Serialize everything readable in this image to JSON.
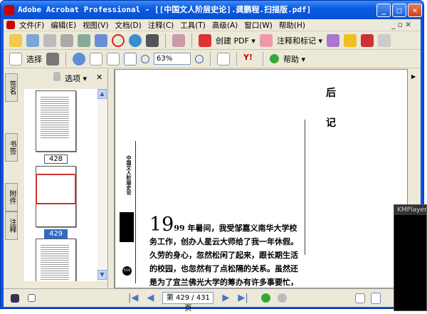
{
  "window": {
    "title": "Adobe Acrobat Professional - [[中国文人阶层史论].龚鹏程.扫描版.pdf]",
    "min": "_",
    "max": "□",
    "close": "✕"
  },
  "menu": [
    "文件(F)",
    "编辑(E)",
    "视图(V)",
    "文档(D)",
    "注释(C)",
    "工具(T)",
    "高级(A)",
    "窗口(W)",
    "帮助(H)"
  ],
  "menu_right": "_ ▫ ✕",
  "toolbar1": {
    "create_pdf": "创建 PDF ▾",
    "comment_markup": "注释和标记 ▾"
  },
  "toolbar2": {
    "select": "选择",
    "zoom_value": "63%",
    "help": "帮助 ▾"
  },
  "left_panel": {
    "options": "选项 ▾",
    "close": "✕",
    "tabs": [
      "签名",
      "书签",
      "附件",
      "注释"
    ],
    "pages": [
      {
        "label": "428",
        "selected": false
      },
      {
        "label": "429",
        "selected": true
      }
    ]
  },
  "document": {
    "heading1": "后",
    "heading2": "记",
    "side_text": "中国文人阶层史论",
    "page_number": "516",
    "drop_cap": "19",
    "body": "99 年暑间，我受邹嘉义南华大学校务工作，创办人星云大师给了我一年休假。久劳的身心，忽然松闲了起来，跟长期生活的校园，也忽然有了点松隔的关系。虽然还是为了宜兰佛光大学的筹办有许多事要忙，却毕竟不用每天上班上课，也无"
  },
  "status": {
    "page_display": "第 429 / 431 页"
  },
  "kmplayer": {
    "title": "KMPlayer"
  }
}
